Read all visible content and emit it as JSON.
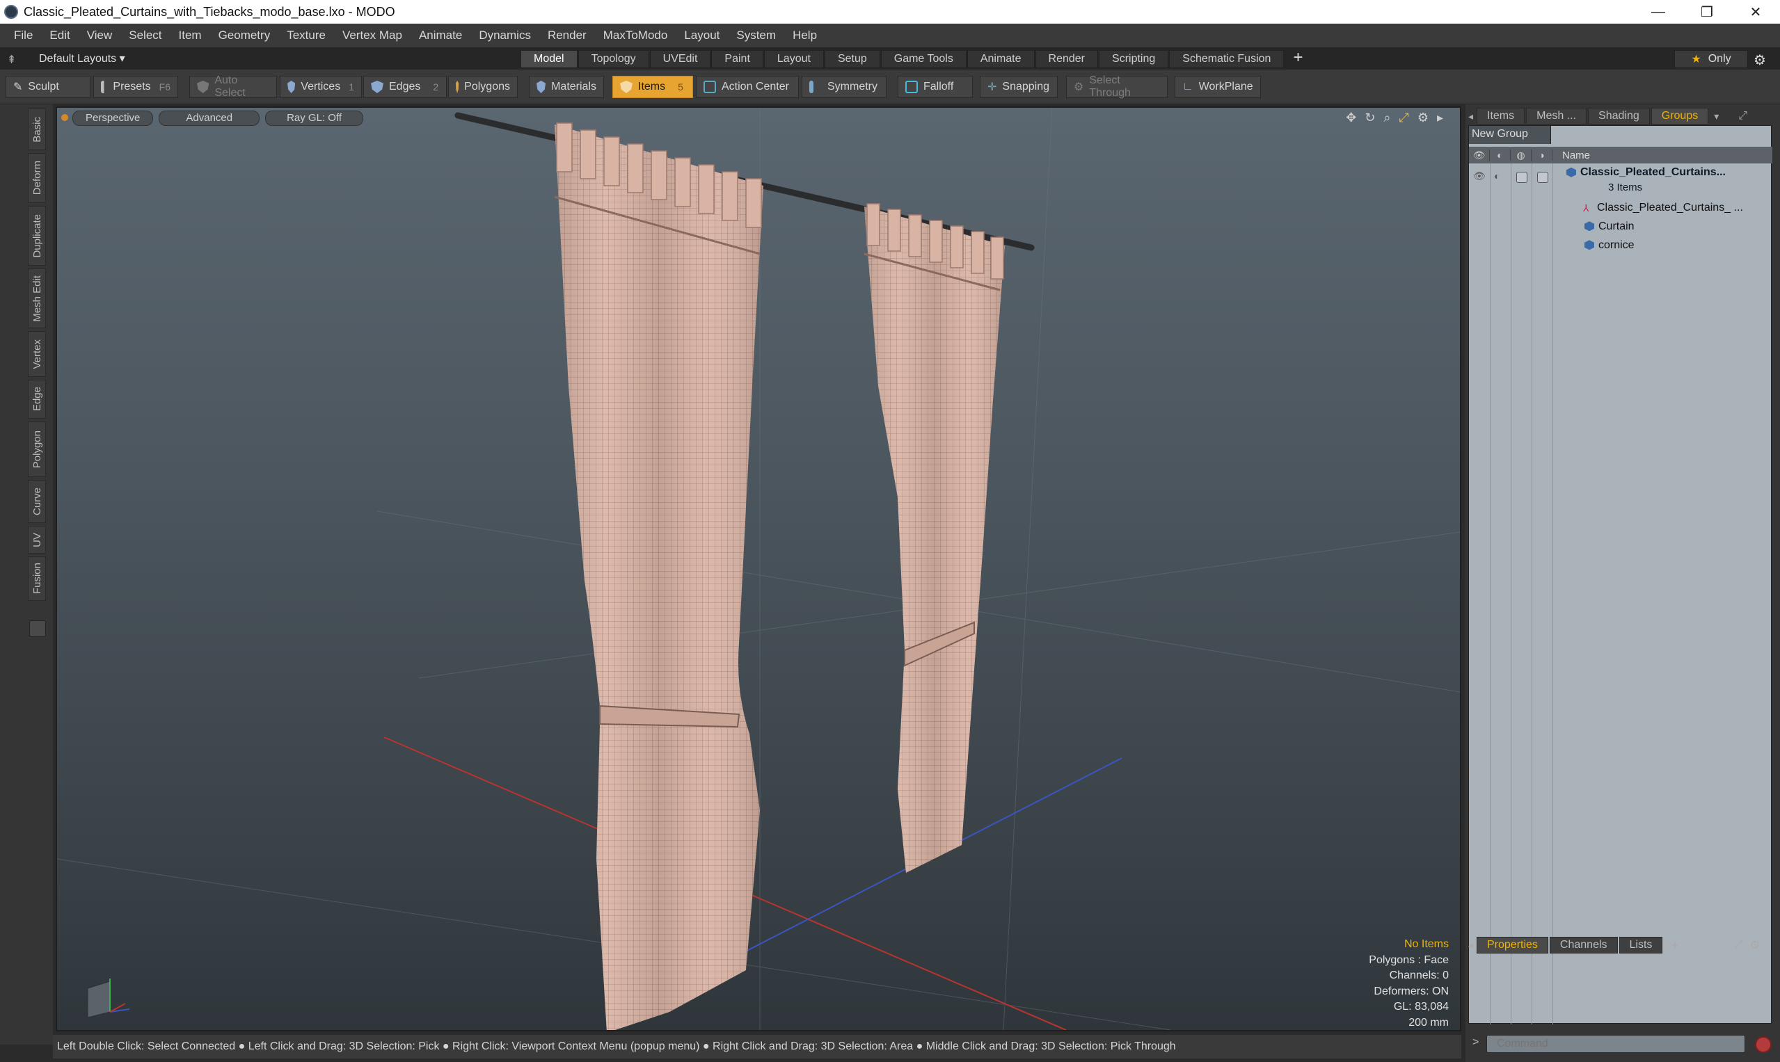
{
  "window": {
    "title": "Classic_Pleated_Curtains_with_Tiebacks_modo_base.lxo - MODO",
    "minimize": "—",
    "maximize": "❐",
    "close": "✕"
  },
  "menu": [
    "File",
    "Edit",
    "View",
    "Select",
    "Item",
    "Geometry",
    "Texture",
    "Vertex Map",
    "Animate",
    "Dynamics",
    "Render",
    "MaxToModo",
    "Layout",
    "System",
    "Help"
  ],
  "layout_bar": {
    "layouts_label": "Default Layouts ▾",
    "tabs": [
      "Model",
      "Topology",
      "UVEdit",
      "Paint",
      "Layout",
      "Setup",
      "Game Tools",
      "Animate",
      "Render",
      "Scripting",
      "Schematic Fusion"
    ],
    "active_tab": "Model",
    "plus": "+",
    "only_label": "Only",
    "only_icon": "star-icon"
  },
  "toolbar": {
    "sculpt": "Sculpt",
    "presets": "Presets",
    "presets_key": "F6",
    "auto_select": "Auto Select",
    "vertices": "Vertices",
    "vertices_key": "1",
    "edges": "Edges",
    "edges_key": "2",
    "polygons": "Polygons",
    "materials": "Materials",
    "items": "Items",
    "items_key": "5",
    "action_center": "Action Center",
    "symmetry": "Symmetry",
    "falloff": "Falloff",
    "snapping": "Snapping",
    "select_through": "Select Through",
    "workplane": "WorkPlane",
    "accent_color": "#e8a431"
  },
  "left_tabs": [
    "Basic",
    "Deform",
    "Duplicate",
    "Mesh Edit",
    "Vertex",
    "Edge",
    "Polygon",
    "Curve",
    "UV",
    "Fusion"
  ],
  "viewport": {
    "tabs": [
      "Perspective",
      "Advanced",
      "Ray GL: Off"
    ],
    "stats": {
      "selection": "No Items",
      "polygons": "Polygons : Face",
      "channels": "Channels: 0",
      "deformers": "Deformers: ON",
      "gl": "GL: 83,084",
      "scale": "200 mm"
    },
    "curtain_color": "#d9b3a4"
  },
  "statusbar": "Left Double Click: Select Connected ● Left Click and Drag: 3D Selection: Pick ● Right Click: Viewport Context Menu (popup menu) ● Right Click and Drag: 3D Selection: Area ● Middle Click and Drag: 3D Selection: Pick Through",
  "right_panel": {
    "tabs": [
      "Items",
      "Mesh ...",
      "Shading",
      "Groups"
    ],
    "active_tab": "Groups",
    "new_group": "New Group",
    "name_header": "Name",
    "tree": {
      "group_name": "Classic_Pleated_Curtains...",
      "group_count": "3 Items",
      "children": [
        "Classic_Pleated_Curtains_ ...",
        "Curtain",
        "cornice"
      ]
    },
    "bottom_tabs": [
      "Properties",
      "Channels",
      "Lists"
    ],
    "bottom_active": "Properties",
    "bottom_plus": "+",
    "command_placeholder": "Command",
    "command_prompt": ">"
  }
}
